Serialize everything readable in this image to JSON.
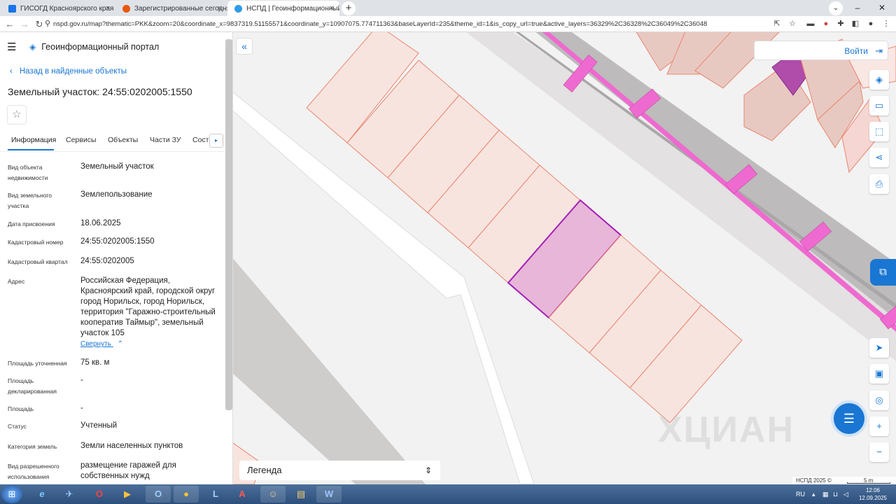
{
  "browser": {
    "tabs": [
      {
        "label": "ГИСОГД Красноярского края",
        "favicon_color": "#1a73e8",
        "active": false
      },
      {
        "label": "Зарегистрированные сегодня",
        "favicon_color": "#e8590c",
        "active": false
      },
      {
        "label": "НСПД | Геоинформационный п",
        "favicon_color": "#2e9be6",
        "active": true
      }
    ],
    "new_tab_label": "+",
    "tab_close": "×",
    "url": "nspd.gov.ru/map?thematic=PKK&zoom=20&coordinate_x=9837319.51155571&coordinate_y=10907075.774711363&baseLayerId=235&theme_id=1&is_copy_url=true&active_layers=36329%2C36328%2C36049%2C36048"
  },
  "header": {
    "menu_icon": "☰",
    "brand_icon": "◈",
    "brand": "Геоинформационный портал"
  },
  "panel": {
    "back_label": "Назад в найденные объекты",
    "title": "Земельный участок: 24:55:0202005:1550",
    "star_icon": "☆",
    "tabs": [
      "Информация",
      "Сервисы",
      "Объекты",
      "Части ЗУ",
      "Соста"
    ],
    "tab_arrow": "▸",
    "props": [
      {
        "label": "Вид объекта недвижимости",
        "value": "Земельный участок"
      },
      {
        "label": "Вид земельного участка",
        "value": "Землепользование"
      },
      {
        "label": "Дата присвоения",
        "value": "18.06.2025"
      },
      {
        "label": "Кадастровый номер",
        "value": "24:55:0202005:1550"
      },
      {
        "label": "Кадастровый квартал",
        "value": "24:55:0202005"
      },
      {
        "label": "Адрес",
        "value": "Российская Федерация, Красноярский край, городской округ город Норильск, город Норильск, территория \"Гаражно-строительный кооператив Таймыр\", земельный участок 105"
      },
      {
        "label": "Площадь уточненная",
        "value": "75 кв. м"
      },
      {
        "label": "Площадь декларированная",
        "value": "-"
      },
      {
        "label": "Площадь",
        "value": "-"
      },
      {
        "label": "Статус",
        "value": "Учтенный"
      },
      {
        "label": "Категория земель",
        "value": "Земли населенных пунктов"
      },
      {
        "label": "Вид разрешенного использования",
        "value": "размещение гаражей для собственных нужд"
      }
    ],
    "collapse_label": "Свернуть",
    "collapse_icon": "⌃"
  },
  "map": {
    "login_label": "Войти",
    "login_icon": "⇥",
    "collapse_icon": "«",
    "tools": [
      {
        "name": "layers-icon",
        "glyph": "◈"
      },
      {
        "name": "ruler-icon",
        "glyph": "▭"
      },
      {
        "name": "select-area-icon",
        "glyph": "⬚"
      },
      {
        "name": "share-icon",
        "glyph": "⋖"
      },
      {
        "name": "print-icon",
        "glyph": "⎙"
      },
      {
        "name": "locate-icon",
        "glyph": "➤"
      },
      {
        "name": "minimap-icon",
        "glyph": "▣"
      },
      {
        "name": "geo-pin-icon",
        "glyph": "◎"
      },
      {
        "name": "zoom-in-icon",
        "glyph": "+"
      },
      {
        "name": "zoom-out-icon",
        "glyph": "−"
      }
    ],
    "legend_label": "Легенда",
    "legend_icon": "⇕",
    "copyright": "НСПД 2025 ©",
    "scale": "5 m",
    "watermark": "ХЦИАН",
    "colors": {
      "parcel_fill": "#f8e4df",
      "parcel_stroke": "#e8866f",
      "selected_fill": "#e7b6d9",
      "selected_stroke": "#a31fb6",
      "utility": "#ee6ad0",
      "road": "#cfcccc"
    }
  },
  "taskbar": {
    "items": [
      {
        "name": "ie-icon",
        "glyph": "e",
        "color": "#2f8fe0"
      },
      {
        "name": "bird-app-icon",
        "glyph": "✈",
        "color": "#3c9be0"
      },
      {
        "name": "opera-icon",
        "glyph": "O",
        "color": "#e0202a"
      },
      {
        "name": "media-icon",
        "glyph": "▶",
        "color": "#f0a020"
      },
      {
        "name": "outlook-icon",
        "glyph": "O",
        "color": "#1060b8"
      },
      {
        "name": "chrome-icon",
        "glyph": "●",
        "color": "#e8b820"
      },
      {
        "name": "lync-icon",
        "glyph": "L",
        "color": "#1a68c0"
      },
      {
        "name": "acrobat-icon",
        "glyph": "A",
        "color": "#c8201a"
      },
      {
        "name": "cert-icon",
        "glyph": "☺",
        "color": "#a08050"
      },
      {
        "name": "folder-icon",
        "glyph": "▤",
        "color": "#e8c060"
      },
      {
        "name": "word-icon",
        "glyph": "W",
        "color": "#2b5eb8"
      }
    ],
    "lang": "RU",
    "time": "12:06",
    "date": "12.09.2025"
  }
}
